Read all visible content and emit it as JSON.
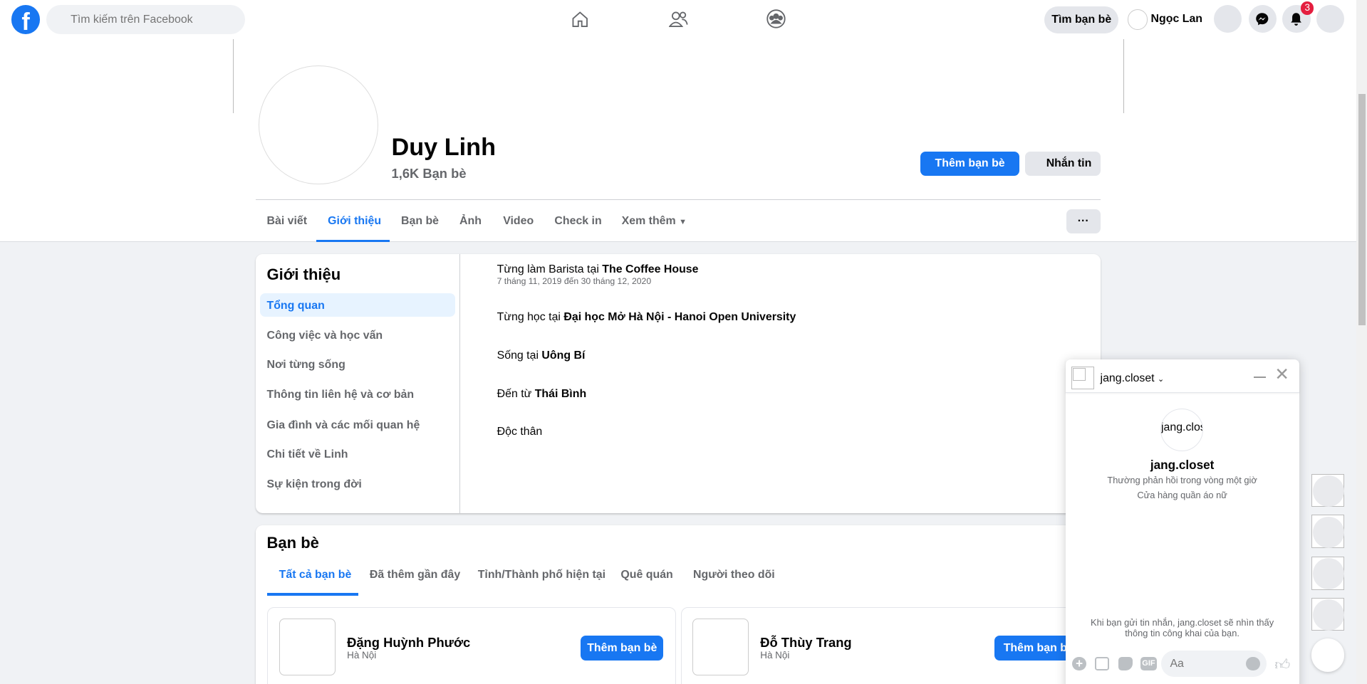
{
  "topbar": {
    "search_placeholder": "Tìm kiếm trên Facebook",
    "find_friends": "Tìm bạn bè",
    "user_name": "Ngọc Lan",
    "notification_count": "3"
  },
  "profile": {
    "name": "Duy Linh",
    "friends_count": "1,6K Bạn bè",
    "add_friend": "Thêm bạn bè",
    "message": "Nhắn tin"
  },
  "tabs": [
    "Bài viết",
    "Giới thiệu",
    "Bạn bè",
    "Ảnh",
    "Video",
    "Check in",
    "Xem thêm"
  ],
  "more_button": "···",
  "intro": {
    "title": "Giới thiệu",
    "menu": [
      "Tổng quan",
      "Công việc và học vấn",
      "Nơi từng sống",
      "Thông tin liên hệ và cơ bản",
      "Gia đình và các mối quan hệ",
      "Chi tiết về Linh",
      "Sự kiện trong đời"
    ],
    "work_prefix": "Từng làm Barista tại ",
    "work_place": "The Coffee House",
    "work_dates": "7 tháng 11, 2019 đến 30 tháng 12, 2020",
    "study_prefix": "Từng học tại ",
    "study_place": "Đại học Mở Hà Nội - Hanoi Open University",
    "live_prefix": "Sống tại ",
    "live_place": "Uông Bí",
    "from_prefix": "Đến từ ",
    "from_place": "Thái Bình",
    "relationship": "Độc thân"
  },
  "friends": {
    "title": "Bạn bè",
    "tabs": [
      "Tất cả bạn bè",
      "Đã thêm gần đây",
      "Tỉnh/Thành phố hiện tại",
      "Quê quán",
      "Người theo dõi"
    ],
    "list": [
      {
        "name": "Đặng Huỳnh Phước",
        "location": "Hà Nội",
        "button": "Thêm bạn bè"
      },
      {
        "name": "Đỗ Thùy Trang",
        "location": "Hà Nội",
        "button": "Thêm bạn bè"
      }
    ]
  },
  "chat": {
    "name": "jang.closet",
    "avatar_alt": "jang.clos",
    "response": "Thường phản hồi trong vòng một giờ",
    "category": "Cửa hàng quần áo nữ",
    "notice": "Khi bạn gửi tin nhắn, jang.closet sẽ nhìn thấy thông tin công khai của bạn.",
    "input_placeholder": "Aa",
    "gif": "GIF"
  },
  "colors": {
    "accent": "#1877f2",
    "badge": "#e41e3f"
  }
}
